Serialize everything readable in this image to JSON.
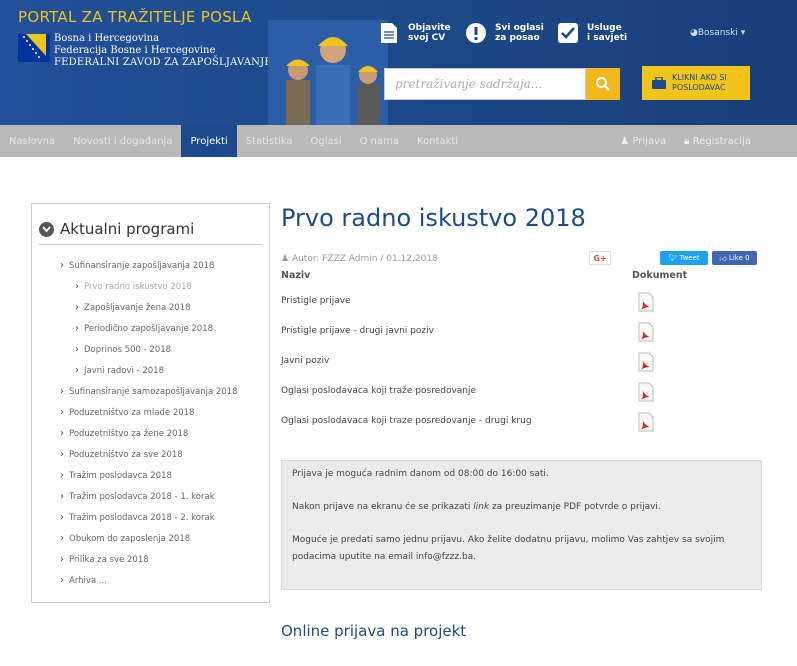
{
  "header": {
    "portal_title": "PORTAL ZA TRAŽITELJE POSLA",
    "org_lines": [
      "Bosna i Hercegovina",
      "Federacija Bosne i Hercegovine",
      "FEDERALNI ZAVOD ZA ZAPOŠLJAVANJE"
    ],
    "btn_cv": [
      "Objavite",
      "svoj CV"
    ],
    "btn_ads": [
      "Svi oglasi",
      "za posao"
    ],
    "btn_services": [
      "Usluge",
      "i savjeti"
    ],
    "language": "Bosanski",
    "search_placeholder": "pretraživanje sadržaja...",
    "employer_btn": [
      "KLIKNI AKO SI",
      "POSLODAVAC"
    ],
    "brand_color": "#1d4a8c",
    "accent_color": "#f0c419"
  },
  "nav": {
    "items": [
      "Naslovna",
      "Novosti i događanja",
      "Projekti",
      "Statistika",
      "Oglasi",
      "O nama",
      "Kontakti"
    ],
    "active": "Projekti",
    "login": "Prijava",
    "register": "Registracija"
  },
  "sidebar": {
    "title": "Aktualni programi",
    "items": [
      {
        "label": "Sufinansiranje zapošljavanja 2018",
        "level": 0
      },
      {
        "label": "Prvo radno iskustvo 2018",
        "level": 1,
        "muted": true
      },
      {
        "label": "Zapošljavanje žena 2018",
        "level": 1
      },
      {
        "label": "Periodično zapošljavanje 2018",
        "level": 1
      },
      {
        "label": "Doprinos 500 - 2018",
        "level": 1
      },
      {
        "label": "Javni radovi - 2018",
        "level": 1
      },
      {
        "label": "Sufinansiranje samozapošljavanja 2018",
        "level": 0
      },
      {
        "label": "Poduzetništvo za mlade 2018",
        "level": 0
      },
      {
        "label": "Poduzetništvo za žene 2018",
        "level": 0
      },
      {
        "label": "Poduzetništvo za sve 2018",
        "level": 0
      },
      {
        "label": "Tražim poslodavca 2018",
        "level": 0
      },
      {
        "label": "Tražim poslodavca 2018 - 1. korak",
        "level": 0
      },
      {
        "label": "Tražim poslodavca 2018 - 2. korak",
        "level": 0
      },
      {
        "label": "Obukom do zaposlenja 2018",
        "level": 0
      },
      {
        "label": "Prilika za sve 2018",
        "level": 0
      },
      {
        "label": "Arhiva ...",
        "level": 0
      }
    ]
  },
  "main": {
    "title": "Prvo radno iskustvo 2018",
    "author": "Autor: FZZZ Admin / 01.12.2018",
    "gplus": "G+",
    "tweet": "Tweet",
    "like": "Like 0",
    "col_name": "Naziv",
    "col_doc": "Dokument",
    "rows": [
      "Pristigle prijave",
      "Pristigle prijave - drugi javni poziv",
      "Javni poziv",
      "Oglasi poslodavaca koji traže posredovanje",
      "Oglasi poslodavaca koji traze posredovanje - drugi krug"
    ],
    "info": {
      "line1": "Prijava je moguća radnim danom od 08:00 do 16:00 sati.",
      "line2_pre": "Nakon prijave na ekranu će se prikazati ",
      "line2_em": "link",
      "line2_post": " za preuzimanje PDF potvrde o prijavi.",
      "line3a": "Moguće je predati samo jednu prijavu. Ako želite dodatnu prijavu, molimo Vas zahtjev sa svojim",
      "line3b": "podacima uputite na email info@fzzz.ba."
    },
    "online_title": "Online prijava na projekt"
  }
}
